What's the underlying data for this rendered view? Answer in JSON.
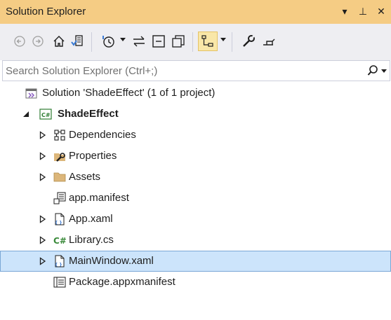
{
  "window": {
    "title": "Solution Explorer",
    "controls": {
      "dropdown": "▾",
      "pin": "⊥",
      "close": "✕"
    }
  },
  "toolbar": {
    "buttons": [
      {
        "name": "back",
        "icon": "back-icon"
      },
      {
        "name": "forward",
        "icon": "forward-icon"
      },
      {
        "name": "home",
        "icon": "home-icon"
      },
      {
        "name": "switch-views",
        "icon": "switch-views-icon"
      },
      {
        "name": "pending-changes",
        "icon": "pending-changes-icon"
      },
      {
        "name": "sync",
        "icon": "sync-icon"
      },
      {
        "name": "collapse-all",
        "icon": "collapse-all-icon"
      },
      {
        "name": "show-all-files",
        "icon": "show-all-files-icon"
      },
      {
        "name": "preview",
        "icon": "preview-icon"
      },
      {
        "name": "properties",
        "icon": "wrench-icon"
      },
      {
        "name": "pin",
        "icon": "pin-icon"
      }
    ]
  },
  "search": {
    "placeholder": "Search Solution Explorer (Ctrl+;)",
    "value": ""
  },
  "tree": {
    "solution": "Solution 'ShadeEffect' (1 of 1 project)",
    "project": "ShadeEffect",
    "items": [
      {
        "label": "Dependencies",
        "icon": "dependencies-icon",
        "expandable": true
      },
      {
        "label": "Properties",
        "icon": "properties-wrench-icon",
        "expandable": true
      },
      {
        "label": "Assets",
        "icon": "folder-icon",
        "expandable": true
      },
      {
        "label": "app.manifest",
        "icon": "manifest-icon",
        "expandable": false
      },
      {
        "label": "App.xaml",
        "icon": "xaml-file-icon",
        "expandable": true
      },
      {
        "label": "Library.cs",
        "icon": "csharp-file-icon",
        "expandable": true
      },
      {
        "label": "MainWindow.xaml",
        "icon": "xaml-file-icon",
        "expandable": true,
        "selected": true
      },
      {
        "label": "Package.appxmanifest",
        "icon": "appxmanifest-icon",
        "expandable": false
      }
    ]
  },
  "colors": {
    "title_bg": "#f5cc84",
    "toolbar_bg": "#eeeef2",
    "selection_bg": "#cce4fb",
    "csharp_green": "#3a8a3a"
  }
}
